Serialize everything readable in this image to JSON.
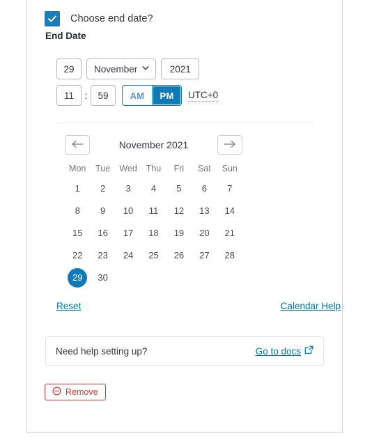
{
  "checkbox": {
    "label": "Choose end date?",
    "checked": true,
    "icon": "check-icon"
  },
  "section": {
    "label": "End Date"
  },
  "date_fields": {
    "day": "29",
    "month": "November",
    "month_icon": "chevron-down-icon",
    "year": "2021",
    "hour": "11",
    "separator": ":",
    "minute": "59",
    "am_label": "AM",
    "pm_label": "PM",
    "meridiem_selected": "PM",
    "timezone": "UTC+0"
  },
  "calendar": {
    "prev_icon": "arrow-left-icon",
    "next_icon": "arrow-right-icon",
    "title": "November 2021",
    "weekdays": [
      "Mon",
      "Tue",
      "Wed",
      "Thu",
      "Fri",
      "Sat",
      "Sun"
    ],
    "leading_blanks": 0,
    "days": [
      1,
      2,
      3,
      4,
      5,
      6,
      7,
      8,
      9,
      10,
      11,
      12,
      13,
      14,
      15,
      16,
      17,
      18,
      19,
      20,
      21,
      22,
      23,
      24,
      25,
      26,
      27,
      28,
      29,
      30
    ],
    "selected_day": 29
  },
  "links": {
    "reset": "Reset",
    "calendar_help": "Calendar Help"
  },
  "help_box": {
    "text": "Need help setting up?",
    "link_label": "Go to docs",
    "link_icon": "external-link-icon"
  },
  "remove_button": {
    "label": "Remove",
    "icon": "circle-minus-icon"
  },
  "colors": {
    "accent": "#0f7ab5",
    "checkbox": "#1b7cb8",
    "link": "#0073aa",
    "danger": "#d63638",
    "border": "#b4b9be",
    "panel_border": "#d4d4d4",
    "divider": "#e2e4e7"
  }
}
